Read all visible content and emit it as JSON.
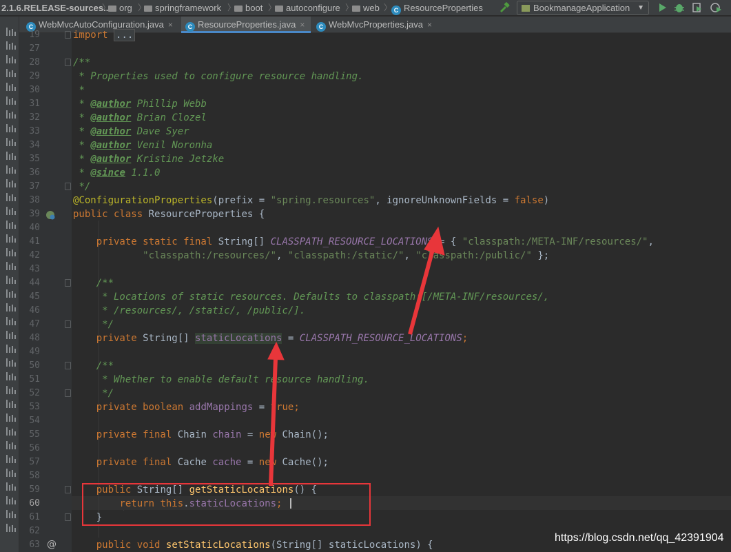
{
  "breadcrumb": {
    "jar": "2.1.6.RELEASE-sources...",
    "parts": [
      "org",
      "springframework",
      "boot",
      "autoconfigure",
      "web"
    ],
    "cls": "ResourceProperties"
  },
  "toolbar": {
    "run_config": "BookmanageApplication"
  },
  "tabs": [
    {
      "label": "WebMvcAutoConfiguration.java",
      "close": "×"
    },
    {
      "label": "ResourceProperties.java",
      "close": "×"
    },
    {
      "label": "WebMvcProperties.java",
      "close": "×"
    }
  ],
  "code": {
    "line_numbers": [
      "19",
      "27",
      "28",
      "29",
      "30",
      "31",
      "32",
      "33",
      "34",
      "35",
      "36",
      "37",
      "38",
      "39",
      "40",
      "41",
      "42",
      "43",
      "44",
      "45",
      "46",
      "47",
      "48",
      "49",
      "50",
      "51",
      "52",
      "53",
      "54",
      "55",
      "56",
      "57",
      "58",
      "59",
      "60",
      "61",
      "62",
      "63"
    ],
    "current_line": "60",
    "t": {
      "import_kw": "import",
      "import_dots": "...",
      "doc_open": "/**",
      "doc_close": "*/",
      "doc_star": "*",
      "doc_desc": " * Properties used to configure resource handling.",
      "author_tag": "@author",
      "since_tag": "@since",
      "authors": [
        "Phillip Webb",
        "Brian Clozel",
        "Dave Syer",
        "Venil Noronha",
        "Kristine Jetzke"
      ],
      "since_ver": "1.1.0",
      "anno": "@ConfigurationProperties",
      "anno_args_a": "(prefix = ",
      "anno_prefix": "\"spring.resources\"",
      "anno_args_b": ", ignoreUnknownFields = ",
      "false_kw": "false",
      "close_paren": ")",
      "class_kw": "public class",
      "class_name": " ResourceProperties {",
      "psf_kw": "private static final",
      "string_arr": " String[] ",
      "const_name": "CLASSPATH_RESOURCE_LOCATIONS",
      "assign_brace": " = { ",
      "str1": "\"classpath:/META-INF/resources/\"",
      "comma": ",",
      "str2": "\"classpath:/resources/\"",
      "comma_sp": ", ",
      "str3": "\"classpath:/static/\"",
      "str4": "\"classpath:/public/\"",
      "close_brace_semi": " };",
      "doc2_l1": " * Locations of static resources. Defaults to classpath:[/META-INF/resources/,",
      "doc2_l2": " * /resources/, /static/, /public/].",
      "private_kw": "private",
      "field_static": "staticLocations",
      "eq": " = ",
      "semi": ";",
      "doc3": " * Whether to enable default resource handling.",
      "boolean_kw": "boolean",
      "field_add": "addMappings",
      "true_kw": "true",
      "private_final_kw": "private final",
      "chain_type": " Chain ",
      "field_chain": "chain",
      "new_kw": "new",
      "chain_ctor": " Chain();",
      "cache_type": " Cache ",
      "field_cache": "cache",
      "cache_ctor": " Cache();",
      "public_kw": "public",
      "getter_name": "getStaticLocations",
      "paren_brace": "() {",
      "return_kw": "return",
      "this_kw": "this",
      "dot": ".",
      "close_brace": "}",
      "void_kw": "void",
      "setter_name": "setStaticLocations",
      "setter_args": "(String[] staticLocations) {"
    }
  },
  "watermark": "https://blog.csdn.net/qq_42391904",
  "colors": {
    "annotation_box": "#e8363a",
    "arrow": "#e8363a"
  }
}
